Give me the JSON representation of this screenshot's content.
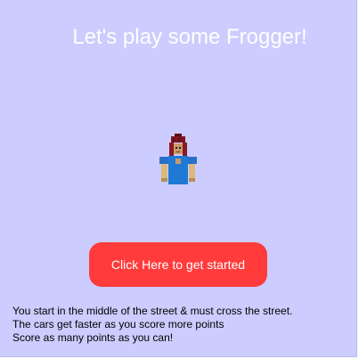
{
  "game": {
    "title": "Let's play some Frogger!",
    "start_button_label": "Click Here to get started",
    "instructions": [
      "You start in the middle of the street & must cross the street.",
      "The cars get faster as you score more points",
      "Score as many points as you can!"
    ],
    "player_sprite_icon": "girl-character-icon"
  },
  "colors": {
    "background": "#ccccff",
    "title_text": "#ffffff",
    "button_bg": "#ff3b3b",
    "button_text": "#ffffff"
  }
}
